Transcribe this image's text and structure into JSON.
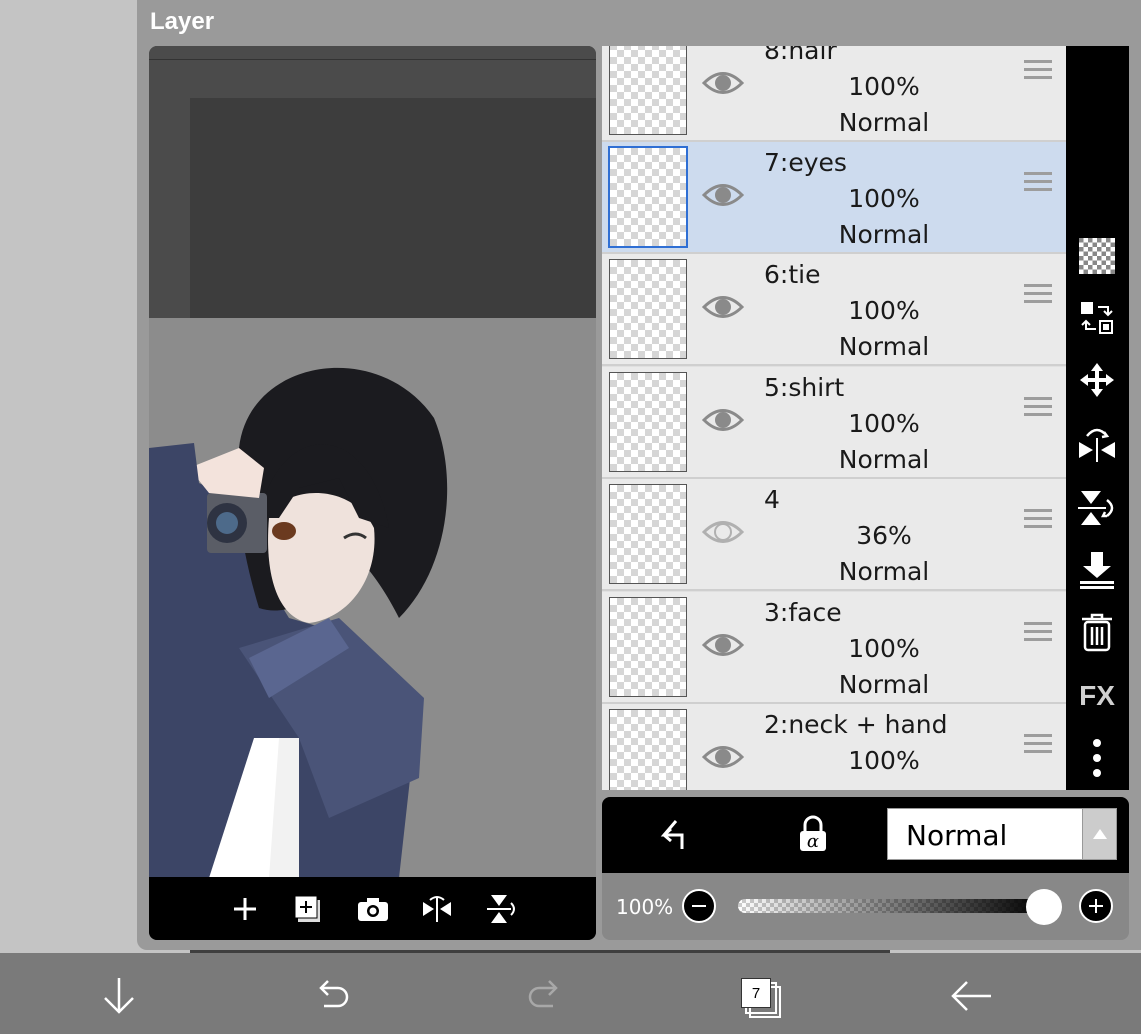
{
  "dialog": {
    "title": "Layer"
  },
  "layers": [
    {
      "name": "8:hair",
      "opacity": "100%",
      "blend": "Normal",
      "visible": true,
      "selected": false,
      "thumb": "hair-thumbnail"
    },
    {
      "name": "7:eyes",
      "opacity": "100%",
      "blend": "Normal",
      "visible": true,
      "selected": true,
      "thumb": "eyes-thumbnail"
    },
    {
      "name": "6:tie",
      "opacity": "100%",
      "blend": "Normal",
      "visible": true,
      "selected": false,
      "thumb": "tie-thumbnail"
    },
    {
      "name": "5:shirt",
      "opacity": "100%",
      "blend": "Normal",
      "visible": true,
      "selected": false,
      "thumb": "shirt-thumbnail"
    },
    {
      "name": "4",
      "opacity": "36%",
      "blend": "Normal",
      "visible": false,
      "selected": false,
      "thumb": "sketch-thumbnail"
    },
    {
      "name": "3:face",
      "opacity": "100%",
      "blend": "Normal",
      "visible": true,
      "selected": false,
      "thumb": "face-thumbnail"
    },
    {
      "name": "2:neck + hand",
      "opacity": "100%",
      "blend": "",
      "visible": true,
      "selected": false,
      "thumb": "neck-hand-thumbnail"
    }
  ],
  "preview_toolbar": [
    "add-layer-icon",
    "add-layer-box-icon",
    "camera-icon",
    "flip-horizontal-icon",
    "flip-vertical-icon"
  ],
  "side_tools": [
    "transparency-icon",
    "swap-icon",
    "move-icon",
    "flip-horizontal-icon",
    "flip-vertical-icon",
    "merge-down-icon",
    "trash-icon",
    "fx-label",
    "more-icon"
  ],
  "fx_label": "FX",
  "blend_bar": {
    "mode": "Normal"
  },
  "opacity": {
    "label": "100%",
    "value": 1.0
  },
  "bottom_nav": {
    "layers_count": "7"
  },
  "colors": {
    "selected_row": "#cddbee",
    "accent": "#2f6fd4"
  }
}
